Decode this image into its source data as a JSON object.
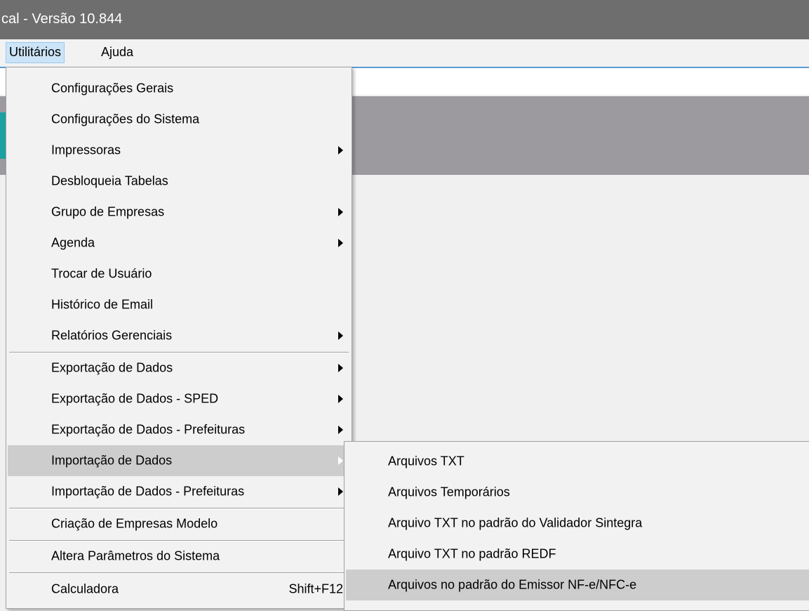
{
  "window": {
    "title": "cal - Versão 10.844"
  },
  "menubar": {
    "items": [
      {
        "label": "Utilitários"
      },
      {
        "label": "Ajuda"
      }
    ]
  },
  "main_menu": {
    "items": [
      {
        "label": "Configurações Gerais",
        "submenu": false
      },
      {
        "label": "Configurações do Sistema",
        "submenu": false
      },
      {
        "label": "Impressoras",
        "submenu": true
      },
      {
        "label": "Desbloqueia Tabelas",
        "submenu": false
      },
      {
        "label": "Grupo de Empresas",
        "submenu": true
      },
      {
        "label": "Agenda",
        "submenu": true
      },
      {
        "label": "Trocar de Usuário",
        "submenu": false
      },
      {
        "label": "Histórico de Email",
        "submenu": false
      },
      {
        "label": "Relatórios Gerenciais",
        "submenu": true
      },
      {
        "label": "Exportação de Dados",
        "submenu": true
      },
      {
        "label": "Exportação de Dados - SPED",
        "submenu": true
      },
      {
        "label": "Exportação de Dados - Prefeituras",
        "submenu": true
      },
      {
        "label": "Importação de Dados",
        "submenu": true,
        "highlighted": true
      },
      {
        "label": "Importação de Dados - Prefeituras",
        "submenu": true
      },
      {
        "label": "Criação de Empresas Modelo",
        "submenu": false
      },
      {
        "label": "Altera Parâmetros do Sistema",
        "submenu": false
      },
      {
        "label": "Calculadora",
        "submenu": false,
        "shortcut": "Shift+F12"
      }
    ]
  },
  "sub_menu": {
    "items": [
      {
        "label": "Arquivos TXT"
      },
      {
        "label": "Arquivos Temporários"
      },
      {
        "label": "Arquivo TXT no padrão do Validador Sintegra"
      },
      {
        "label": "Arquivo TXT no padrão REDF"
      },
      {
        "label": "Arquivos no padrão do Emissor NF-e/NFC-e",
        "highlighted": true
      }
    ]
  },
  "colors": {
    "titlebar": "#6e6e6e",
    "menu_bg": "#f2f2f2",
    "highlight": "#cdcdcd",
    "header_band": "#9c9a9f",
    "accent_teal": "#1ba1a1",
    "toolbar_line": "#5b9bd5"
  }
}
